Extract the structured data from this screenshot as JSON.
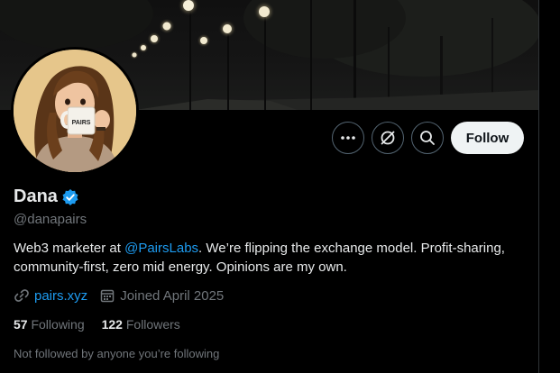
{
  "profile": {
    "display_name": "Dana",
    "handle": "@danapairs",
    "verified": true,
    "bio_prefix": "Web3 marketer at ",
    "bio_mention": "@PairsLabs",
    "bio_suffix": ". We’re flipping the exchange model. Profit-sharing, community-first, zero mid energy. Opinions are my own.",
    "website": "pairs.xyz",
    "joined": "Joined April 2025",
    "following_count": "57",
    "following_label": "Following",
    "followers_count": "122",
    "followers_label": "Followers",
    "mutuals_note": "Not followed by anyone you’re following",
    "avatar_mug_text": "PAIRS"
  },
  "actions": {
    "more_icon": "more-horizontal-icon",
    "grok_icon": "grok-icon",
    "search_icon": "search-icon",
    "follow_label": "Follow"
  },
  "colors": {
    "accent": "#1d9bf0",
    "background": "#000000",
    "text_primary": "#e7e9ea",
    "text_secondary": "#71767b",
    "follow_button_bg": "#eff3f4"
  }
}
